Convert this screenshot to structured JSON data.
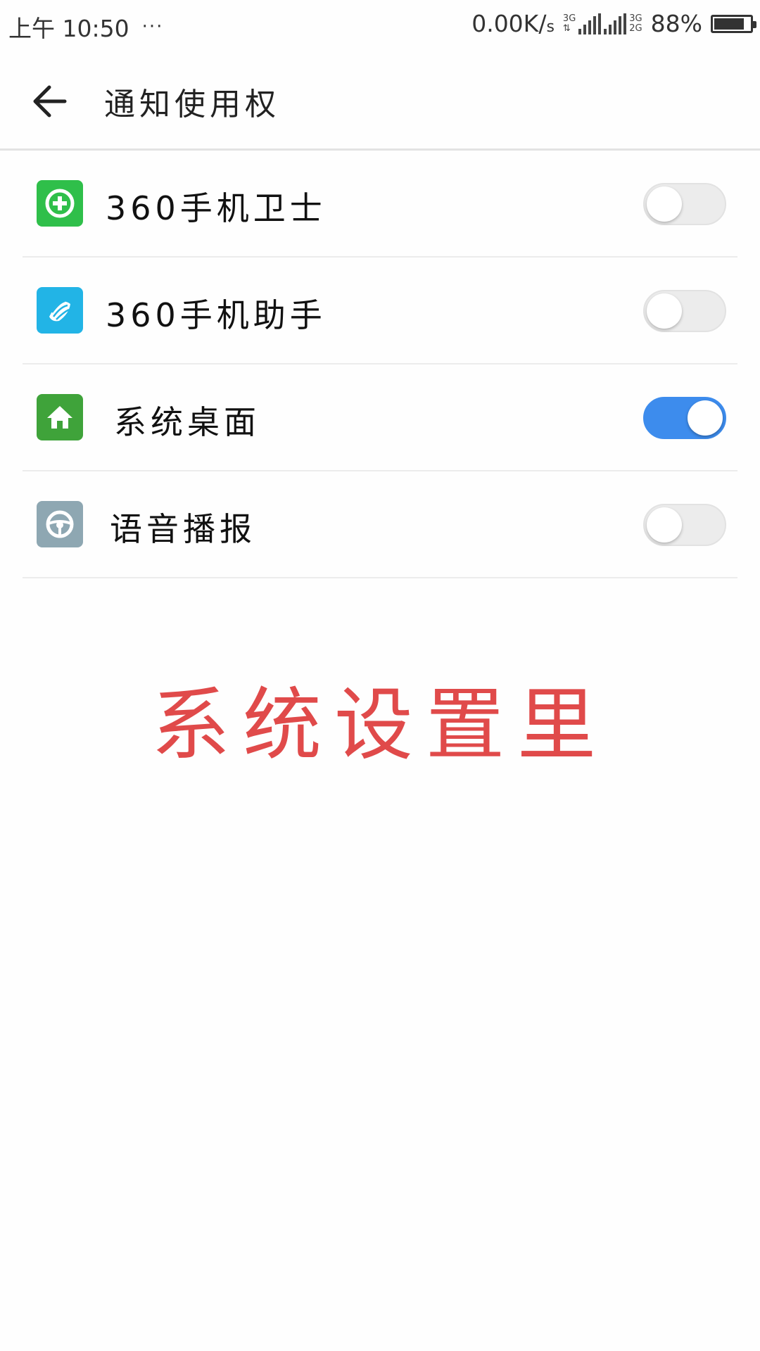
{
  "status_bar": {
    "time": "上午 10:50",
    "more": "···",
    "net_speed_value": "0.00K/",
    "net_speed_unit": "s",
    "network_tag_top_left": "3G",
    "network_tag_bottom_left": "⇅",
    "network_tag_top_right": "3G",
    "network_tag_bottom_right": "2G",
    "battery": "88%",
    "battery_level": 0.88
  },
  "header": {
    "title": "通知使用权",
    "back_icon": "arrow-left-icon"
  },
  "apps": [
    {
      "label": "360手机卫士",
      "icon": "360-security-icon",
      "icon_color": "#2fbf4a",
      "enabled": false
    },
    {
      "label": "360手机助手",
      "icon": "360-assistant-icon",
      "icon_color": "#22b4e6",
      "enabled": false
    },
    {
      "label": "系统桌面",
      "icon": "home-icon",
      "icon_color": "#3fa33a",
      "enabled": true
    },
    {
      "label": "语音播报",
      "icon": "steering-wheel-icon",
      "icon_color": "#8ea7b2",
      "enabled": false
    }
  ],
  "annotation": "系统设置里",
  "colors": {
    "toggle_on": "#3d8ced",
    "annotation": "#e04a4a"
  }
}
